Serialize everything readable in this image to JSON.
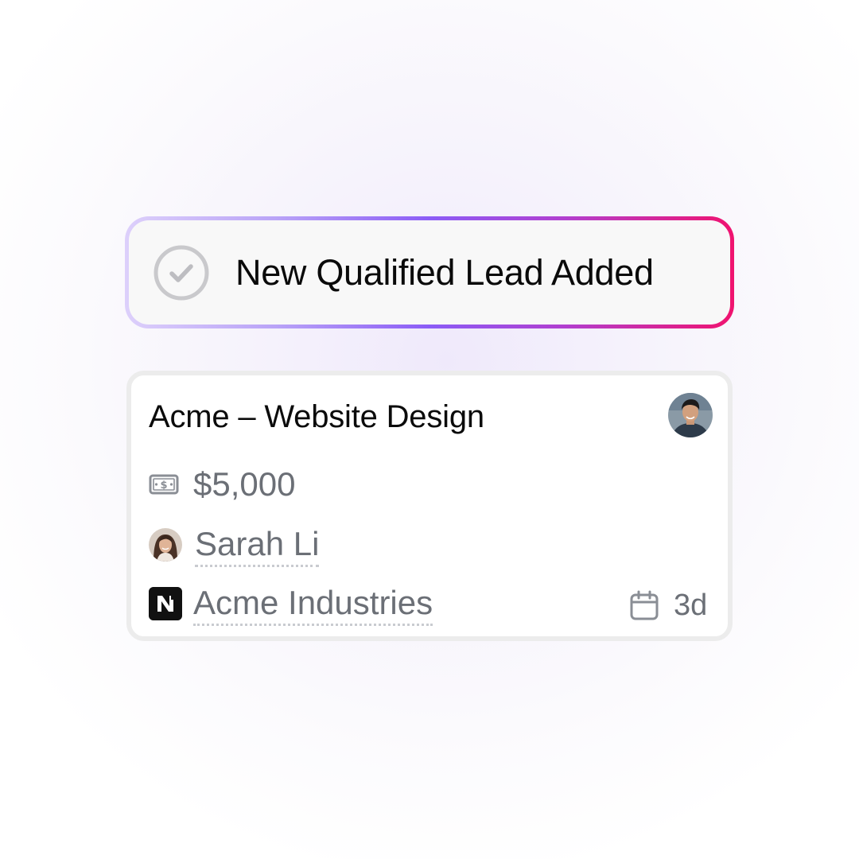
{
  "notification": {
    "title": "New Qualified Lead Added",
    "icon": "check-circle-icon",
    "border_gradient": [
      "#ddd0fb",
      "#8b5cf6",
      "#f0136f"
    ]
  },
  "deal_card": {
    "title": "Acme – Website Design",
    "owner_avatar": "avatar",
    "amount": "$5,000",
    "amount_icon": "money-icon",
    "contact": "Sarah Li",
    "company": "Acme Industries",
    "company_icon": "company-logo",
    "due": "3d",
    "due_icon": "calendar-icon"
  },
  "colors": {
    "accent_purple": "#8b5cf6",
    "accent_pink": "#f0136f",
    "muted_text": "#6b6f76"
  }
}
